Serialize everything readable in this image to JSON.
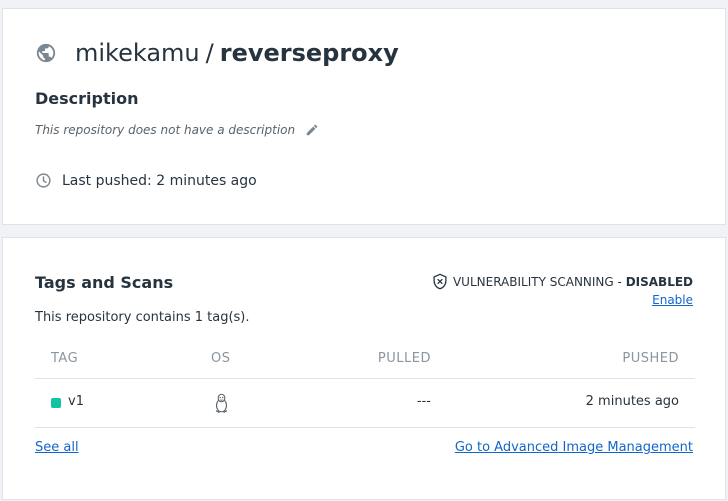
{
  "repository": {
    "owner": "mikekamu",
    "separator": "/",
    "name": "reverseproxy",
    "description_heading": "Description",
    "description_text": "This repository does not have a description",
    "last_pushed": "Last pushed: 2 minutes ago"
  },
  "tags_scans": {
    "heading": "Tags and Scans",
    "scan_label": "VULNERABILITY SCANNING",
    "scan_sep": " - ",
    "scan_state": "DISABLED",
    "enable_link": "Enable",
    "tag_count_text": "This repository contains 1 tag(s).",
    "columns": [
      "TAG",
      "OS",
      "PULLED",
      "PUSHED"
    ],
    "rows": [
      {
        "tag": "v1",
        "os": "linux-icon",
        "pulled": "---",
        "pushed": "2 minutes ago",
        "status_color": "#11c3a3"
      }
    ],
    "see_all": "See all",
    "advanced_link": "Go to Advanced Image Management"
  },
  "icons": [
    "globe-icon",
    "pencil-icon",
    "clock-icon",
    "shield-x-icon",
    "linux-icon"
  ],
  "colors": {
    "link": "#1366c9",
    "text": "#27343f",
    "muted": "#8a959e",
    "tag_status": "#11c3a3"
  }
}
